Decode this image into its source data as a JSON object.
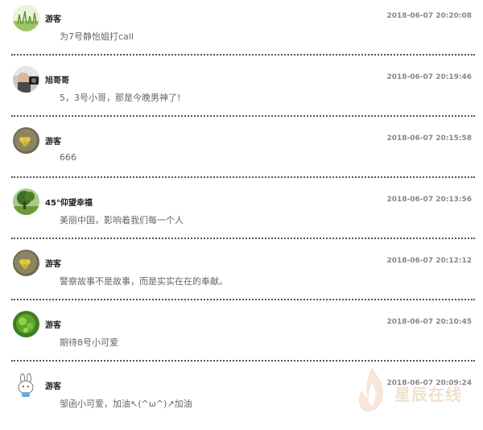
{
  "comments": [
    {
      "username": "游客",
      "time": "2018-06-07 20:20:08",
      "text": "为7号静怡姐打call",
      "avatar_icon": "grass-avatar-icon"
    },
    {
      "username": "旭哥哥",
      "time": "2018-06-07 20:19:46",
      "text": "5，3号小哥，那是今晚男神了!",
      "avatar_icon": "man-photo-avatar-icon"
    },
    {
      "username": "游客",
      "time": "2018-06-07 20:15:58",
      "text": "666",
      "avatar_icon": "flower-avatar-icon"
    },
    {
      "username": "45°仰望幸福",
      "time": "2018-06-07 20:13:56",
      "text": "美丽中国，影响着我们每一个人",
      "avatar_icon": "tree-avatar-icon"
    },
    {
      "username": "游客",
      "time": "2018-06-07 20:12:12",
      "text": "警察故事不是故事，而是实实在在的奉献。",
      "avatar_icon": "flower-avatar-icon"
    },
    {
      "username": "游客",
      "time": "2018-06-07 20:10:45",
      "text": "期待8号小可爱",
      "avatar_icon": "green-leaf-avatar-icon"
    },
    {
      "username": "游客",
      "time": "2018-06-07 20:09:24",
      "text": "邹函小可爱，加油↖(^ω^)↗加油",
      "avatar_icon": "bunny-avatar-icon"
    }
  ],
  "watermark": {
    "text": "星辰在线"
  },
  "colors": {
    "separator": "#555555",
    "username": "#222222",
    "timestamp": "#888888",
    "text": "#666666"
  }
}
